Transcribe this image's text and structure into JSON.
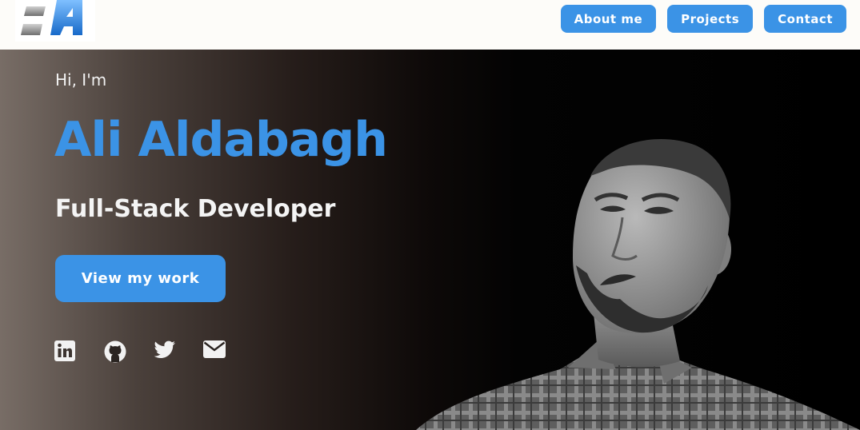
{
  "header": {
    "logo": {
      "text": "A"
    },
    "nav": [
      {
        "label": "About me"
      },
      {
        "label": "Projects"
      },
      {
        "label": "Contact"
      }
    ]
  },
  "hero": {
    "greeting": "Hi, I'm",
    "name": "Ali Aldabagh",
    "role": "Full-Stack Developer",
    "cta_label": "View my work",
    "socials": [
      {
        "icon": "linkedin-icon"
      },
      {
        "icon": "github-icon"
      },
      {
        "icon": "twitter-icon"
      },
      {
        "icon": "mail-icon"
      }
    ]
  },
  "colors": {
    "accent": "#3b93e6",
    "header_bg": "#fdfcf9",
    "text_light": "#f4f4f4"
  }
}
